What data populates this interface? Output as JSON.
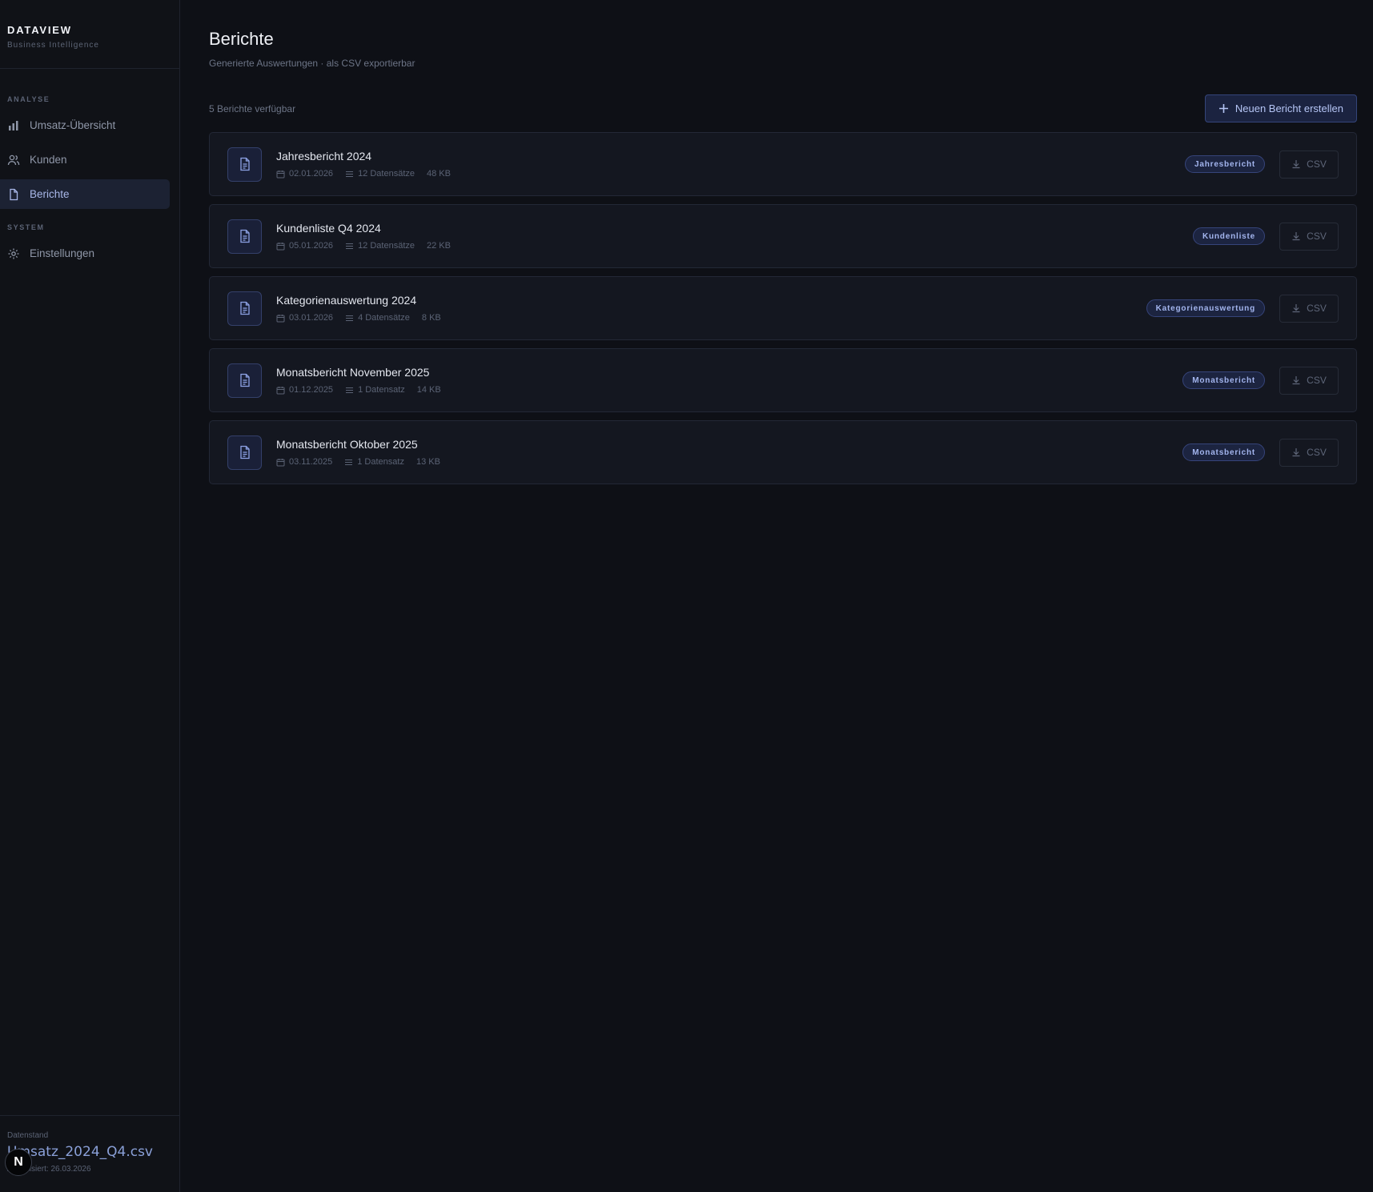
{
  "brand": {
    "title": "DATAVIEW",
    "subtitle": "Business Intelligence"
  },
  "sidebar": {
    "sections": [
      {
        "label": "ANALYSE",
        "items": [
          {
            "label": "Umsatz-Übersicht",
            "icon": "bar-chart-icon",
            "active": false
          },
          {
            "label": "Kunden",
            "icon": "users-icon",
            "active": false
          },
          {
            "label": "Berichte",
            "icon": "document-icon",
            "active": true
          }
        ]
      },
      {
        "label": "SYSTEM",
        "items": [
          {
            "label": "Einstellungen",
            "icon": "gear-icon",
            "active": false
          }
        ]
      }
    ],
    "footer": {
      "label": "Datenstand",
      "file": "Umsatz_2024_Q4.csv",
      "updated": "Aktualisiert: 26.03.2026",
      "badge": "N"
    }
  },
  "page": {
    "title": "Berichte",
    "subtitle": "Generierte Auswertungen · als CSV exportierbar",
    "count": "5 Berichte verfügbar",
    "create_label": "Neuen Bericht erstellen"
  },
  "reports": [
    {
      "title": "Jahresbericht 2024",
      "date": "02.01.2026",
      "records": "12 Datensätze",
      "size": "48 KB",
      "tag": "Jahresbericht",
      "action": "CSV"
    },
    {
      "title": "Kundenliste Q4 2024",
      "date": "05.01.2026",
      "records": "12 Datensätze",
      "size": "22 KB",
      "tag": "Kundenliste",
      "action": "CSV"
    },
    {
      "title": "Kategorienauswertung 2024",
      "date": "03.01.2026",
      "records": "4 Datensätze",
      "size": "8 KB",
      "tag": "Kategorienauswertung",
      "action": "CSV"
    },
    {
      "title": "Monatsbericht November 2025",
      "date": "01.12.2025",
      "records": "1 Datensatz",
      "size": "14 KB",
      "tag": "Monatsbericht",
      "action": "CSV"
    },
    {
      "title": "Monatsbericht Oktober 2025",
      "date": "03.11.2025",
      "records": "1 Datensatz",
      "size": "13 KB",
      "tag": "Monatsbericht",
      "action": "CSV"
    }
  ],
  "colors": {
    "accent": "#a8b7e8",
    "background": "#0e1016",
    "card": "#141720"
  }
}
